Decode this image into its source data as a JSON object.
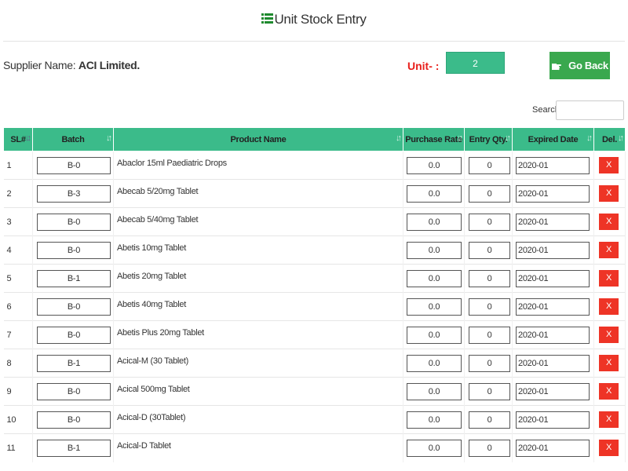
{
  "page": {
    "title": "Unit Stock Entry"
  },
  "supplier": {
    "label": "Supplier Name:",
    "value": "ACI Limited."
  },
  "unit": {
    "label": "Unit- :",
    "value": "2"
  },
  "go_back": {
    "label": "Go Back"
  },
  "search": {
    "label": "Search:",
    "value": ""
  },
  "table": {
    "headers": [
      "SL#",
      "Batch",
      "Product Name",
      "Purchase Rate",
      "Entry Qty.",
      "Expired Date",
      "Del."
    ],
    "delete_label": "X",
    "rows": [
      {
        "sl": "1",
        "batch": "B-0",
        "product": "Abaclor 15ml Paediatric Drops",
        "rate": "0.0",
        "qty": "0",
        "expiry": "2020-01"
      },
      {
        "sl": "2",
        "batch": "B-3",
        "product": "Abecab 5/20mg Tablet",
        "rate": "0.0",
        "qty": "0",
        "expiry": "2020-01"
      },
      {
        "sl": "3",
        "batch": "B-0",
        "product": "Abecab 5/40mg Tablet",
        "rate": "0.0",
        "qty": "0",
        "expiry": "2020-01"
      },
      {
        "sl": "4",
        "batch": "B-0",
        "product": "Abetis 10mg Tablet",
        "rate": "0.0",
        "qty": "0",
        "expiry": "2020-01"
      },
      {
        "sl": "5",
        "batch": "B-1",
        "product": "Abetis 20mg Tablet",
        "rate": "0.0",
        "qty": "0",
        "expiry": "2020-01"
      },
      {
        "sl": "6",
        "batch": "B-0",
        "product": "Abetis 40mg Tablet",
        "rate": "0.0",
        "qty": "0",
        "expiry": "2020-01"
      },
      {
        "sl": "7",
        "batch": "B-0",
        "product": "Abetis Plus 20mg Tablet",
        "rate": "0.0",
        "qty": "0",
        "expiry": "2020-01"
      },
      {
        "sl": "8",
        "batch": "B-1",
        "product": "Acical-M (30 Tablet)",
        "rate": "0.0",
        "qty": "0",
        "expiry": "2020-01"
      },
      {
        "sl": "9",
        "batch": "B-0",
        "product": "Acical 500mg Tablet",
        "rate": "0.0",
        "qty": "0",
        "expiry": "2020-01"
      },
      {
        "sl": "10",
        "batch": "B-0",
        "product": "Acical-D (30Tablet)",
        "rate": "0.0",
        "qty": "0",
        "expiry": "2020-01"
      },
      {
        "sl": "11",
        "batch": "B-1",
        "product": "Acical-D Tablet",
        "rate": "0.0",
        "qty": "0",
        "expiry": "2020-01"
      }
    ]
  }
}
